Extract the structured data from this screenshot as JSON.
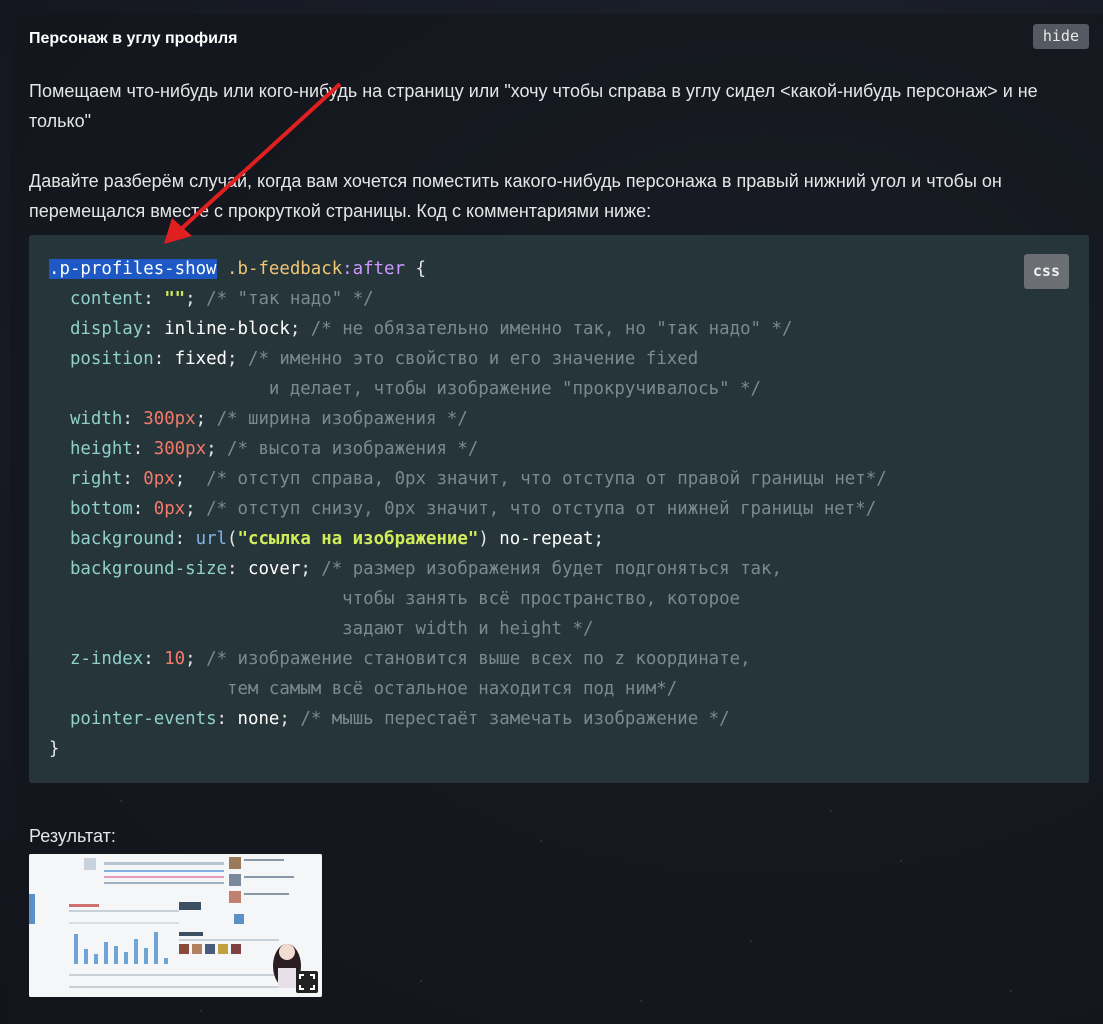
{
  "panel": {
    "title": "Персонаж в углу профиля",
    "hide_label": "hide"
  },
  "intro": {
    "paragraph1": "Помещаем что-нибудь или кого-нибудь на страницу или \"хочу чтобы справа в углу сидел <какой-нибудь персонаж> и не только\"",
    "paragraph2": "Давайте разберём случай, когда вам хочется поместить какого-нибудь персонажа в правый нижний угол и чтобы он перемещался вместе с прокруткой страницы. Код с комментариями ниже:"
  },
  "code": {
    "language": "css",
    "selector_highlight": ".p-profiles-show",
    "selector_rest": " .b-feedback",
    "pseudo": ":after",
    "open_brace": " {",
    "close_brace": "}",
    "lines": [
      {
        "prop": "content",
        "val": "\"\"",
        "comment": "/* \"так надо\" */"
      },
      {
        "prop": "display",
        "val": "inline-block",
        "comment": "/* не обязательно именно так, но \"так надо\" */"
      },
      {
        "prop": "position",
        "val": "fixed",
        "comment": "/* именно это свойство и его значение fixed"
      },
      {
        "continuation": "                     и делает, чтобы изображение \"прокручивалось\" */"
      },
      {
        "prop": "width",
        "val": "300px",
        "comment": "/* ширина изображения */"
      },
      {
        "prop": "height",
        "val": "300px",
        "comment": "/* высота изображения */"
      },
      {
        "prop": "right",
        "val": "0px",
        "comment": " /* отступ справа, 0px значит, что отступа от правой границы нет*/"
      },
      {
        "prop": "bottom",
        "val": "0px",
        "comment": "/* отступ снизу, 0px значит, что отступа от нижней границы нет*/"
      },
      {
        "prop": "background",
        "fn": "url",
        "arg": "\"ссылка на изображение\"",
        "val": " no-repeat"
      },
      {
        "prop": "background-size",
        "val": "cover",
        "comment": "/* размер изображения будет подгоняться так,"
      },
      {
        "continuation": "                            чтобы занять всё пространство, которое"
      },
      {
        "continuation": "                            задают width и height */"
      },
      {
        "prop": "z-index",
        "val": "10",
        "comment": "/* изображение становится выше всех по z координате,"
      },
      {
        "continuation": "                 тем самым всё остальное находится под ним*/"
      },
      {
        "prop": "pointer-events",
        "val": "none",
        "comment": "/* мышь перестаёт замечать изображение */"
      }
    ]
  },
  "result": {
    "label": "Результат:"
  },
  "colors": {
    "arrow": "#e02020",
    "selection": "#1d58c4",
    "code_bg": "#26353a"
  }
}
